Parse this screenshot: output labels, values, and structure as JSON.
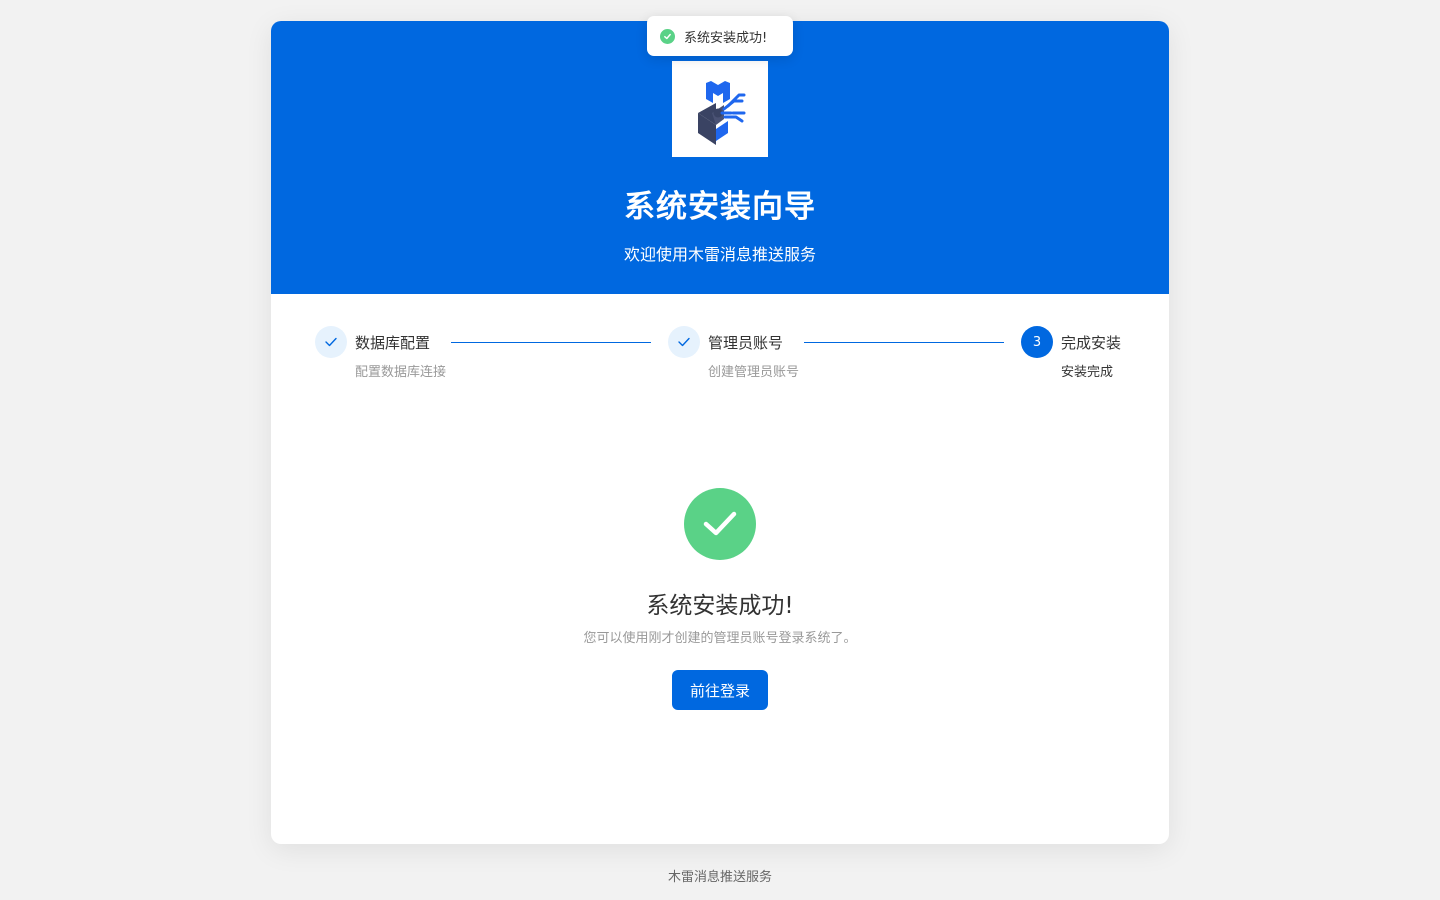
{
  "toast": {
    "text": "系统安装成功!",
    "icon": "check-circle-icon"
  },
  "header": {
    "logo": "mulei-logo",
    "title": "系统安装向导",
    "subtitle": "欢迎使用木雷消息推送服务"
  },
  "steps": [
    {
      "title": "数据库配置",
      "desc": "配置数据库连接",
      "status": "done",
      "icon": "check-icon"
    },
    {
      "title": "管理员账号",
      "desc": "创建管理员账号",
      "status": "done",
      "icon": "check-icon"
    },
    {
      "title": "完成安装",
      "desc": "安装完成",
      "status": "active",
      "number": "3"
    }
  ],
  "result": {
    "icon": "check-circle-icon",
    "title": "系统安装成功!",
    "desc": "您可以使用刚才创建的管理员账号登录系统了。",
    "button_label": "前往登录"
  },
  "footer": {
    "text": "木雷消息推送服务"
  },
  "colors": {
    "primary": "#0068e0",
    "success": "#5ad287",
    "background": "#f2f2f2",
    "step_done_bg": "#e6f2fd"
  }
}
